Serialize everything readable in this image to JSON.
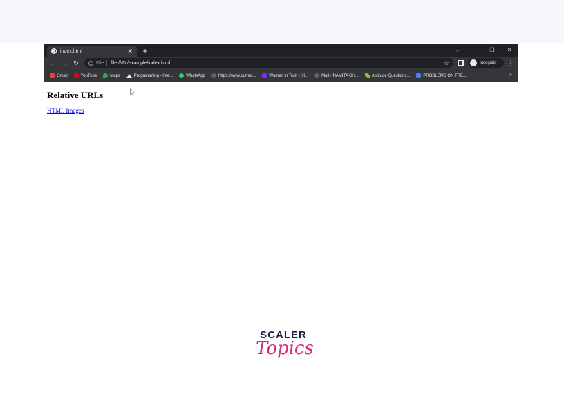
{
  "browser": {
    "tab": {
      "title": "index.html",
      "close": "✕"
    },
    "new_tab": "+",
    "window_controls": {
      "tab_search": "⌵",
      "minimize": "–",
      "restore": "❐",
      "close": "✕"
    },
    "nav": {
      "back": "←",
      "forward": "→",
      "reload": "↻"
    },
    "omnibox": {
      "scheme_label": "File",
      "url": "file:///D:/example/index.html",
      "star": "☆"
    },
    "profile_label": "Incognito",
    "menu": "⋮",
    "bookmarks": [
      {
        "label": "Gmail",
        "color": "#ea4335"
      },
      {
        "label": "YouTube",
        "color": "#ff0000"
      },
      {
        "label": "Maps",
        "color": "#34a853"
      },
      {
        "label": "Programming - Inte...",
        "color": "#e8eaed"
      },
      {
        "label": "WhatsApp",
        "color": "#25d366"
      },
      {
        "label": "https://www.outrea...",
        "color": "#5f6368"
      },
      {
        "label": "Women in Tech Hiri...",
        "color": "#7b2ff7"
      },
      {
        "label": "Mail - NAMITA CH...",
        "color": "#5f6368"
      },
      {
        "label": "Aptitude Questions...",
        "color": "#8bc34a"
      },
      {
        "label": "PROBLEMS ON TRE...",
        "color": "#4285f4"
      }
    ],
    "bookmarks_more": "»"
  },
  "page": {
    "heading": "Relative URLs",
    "link": "HTML Images"
  },
  "logo": {
    "top": "SCALER",
    "bottom": "Topics",
    "colors": {
      "top": "#1b2142",
      "bottom": "#e0267a"
    }
  }
}
